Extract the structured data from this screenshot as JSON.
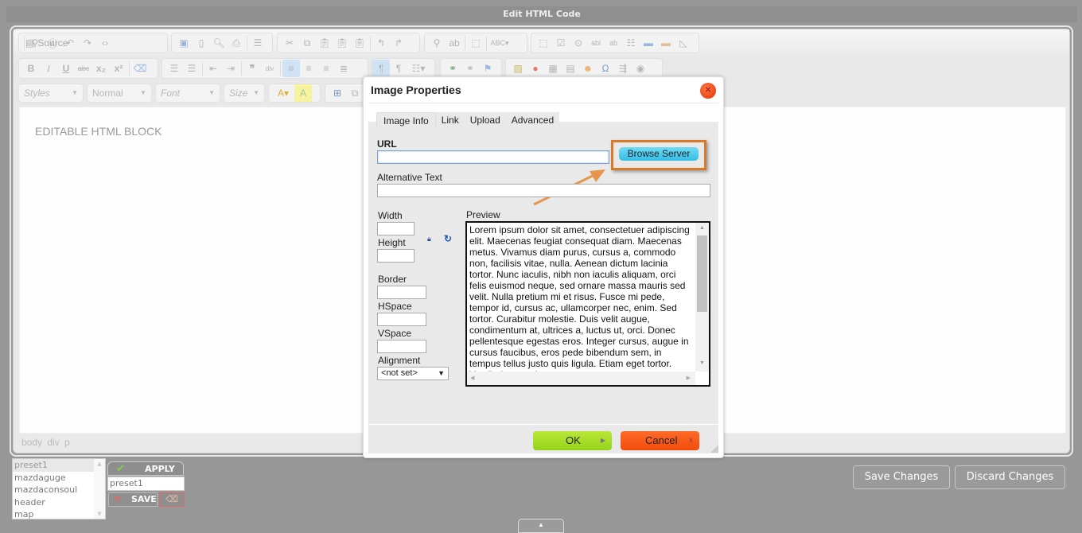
{
  "window": {
    "title": "Edit HTML Code"
  },
  "toolbar": {
    "row1": {
      "source_label": "Source",
      "groups": [
        [
          "document-icon",
          "source-icon"
        ],
        [
          "find-icon",
          "select-all-icon",
          "undo-icon",
          "redo-icon",
          "code-icon"
        ],
        [
          "save-icon",
          "new-page-icon",
          "preview-icon",
          "print-icon"
        ],
        [
          "templates-icon"
        ],
        [
          "cut-icon",
          "copy-icon",
          "paste-icon",
          "paste-text-icon",
          "paste-word-icon",
          "undo-arrow-icon",
          "redo-arrow-icon"
        ],
        [
          "find-icon",
          "replace-icon",
          "select-all-icon",
          "spellcheck-icon"
        ],
        [
          "form-icon",
          "checkbox-icon",
          "radio-icon",
          "textfield-icon",
          "textarea-icon",
          "select-icon",
          "button-icon",
          "image-button-icon",
          "hidden-field-icon"
        ]
      ]
    },
    "row2": {
      "bold": "B",
      "italic": "I",
      "underline": "U",
      "strike": "abc",
      "subscript": "x₂",
      "superscript": "x²"
    },
    "row3": {
      "styles": "Styles",
      "format": "Normal",
      "font": "Font",
      "size": "Size"
    }
  },
  "editor": {
    "content": "EDITABLE HTML BLOCK",
    "path": [
      "body",
      "div",
      "p"
    ]
  },
  "dialog": {
    "title": "Image Properties",
    "tabs": [
      "Image Info",
      "Link",
      "Upload",
      "Advanced"
    ],
    "active_tab": "Image Info",
    "url_label": "URL",
    "url_value": "",
    "browse_label": "Browse Server",
    "alt_label": "Alternative Text",
    "alt_value": "",
    "width_label": "Width",
    "height_label": "Height",
    "border_label": "Border",
    "hspace_label": "HSpace",
    "vspace_label": "VSpace",
    "alignment_label": "Alignment",
    "alignment_value": "<not set>",
    "preview_label": "Preview",
    "preview_text": "Lorem ipsum dolor sit amet, consectetuer adipiscing elit. Maecenas feugiat consequat diam. Maecenas metus. Vivamus diam purus, cursus a, commodo non, facilisis vitae, nulla. Aenean dictum lacinia tortor. Nunc iaculis, nibh non iaculis aliquam, orci felis euismod neque, sed ornare massa mauris sed velit. Nulla pretium mi et risus. Fusce mi pede, tempor id, cursus ac, ullamcorper nec, enim. Sed tortor. Curabitur molestie. Duis velit augue, condimentum at, ultrices a, luctus ut, orci. Donec pellentesque egestas eros. Integer cursus, augue in cursus faucibus, eros pede bibendum sem, in tempus tellus justo quis ligula. Etiam eget tortor. Vestibulum turpis.",
    "ok_label": "OK",
    "cancel_label": "Cancel"
  },
  "presets": {
    "items": [
      "preset1",
      "mazdaguge",
      "mazdaconsoul",
      "header",
      "map"
    ],
    "selected": "preset1",
    "apply_label": "APPLY",
    "name_value": "preset1",
    "save_label": "SAVE"
  },
  "actions": {
    "save_changes": "Save Changes",
    "discard_changes": "Discard Changes"
  },
  "colors": {
    "highlight": "#d97a2b",
    "ok": "#a6dc28",
    "cancel": "#f45a16",
    "browse": "#4cc9ec"
  }
}
